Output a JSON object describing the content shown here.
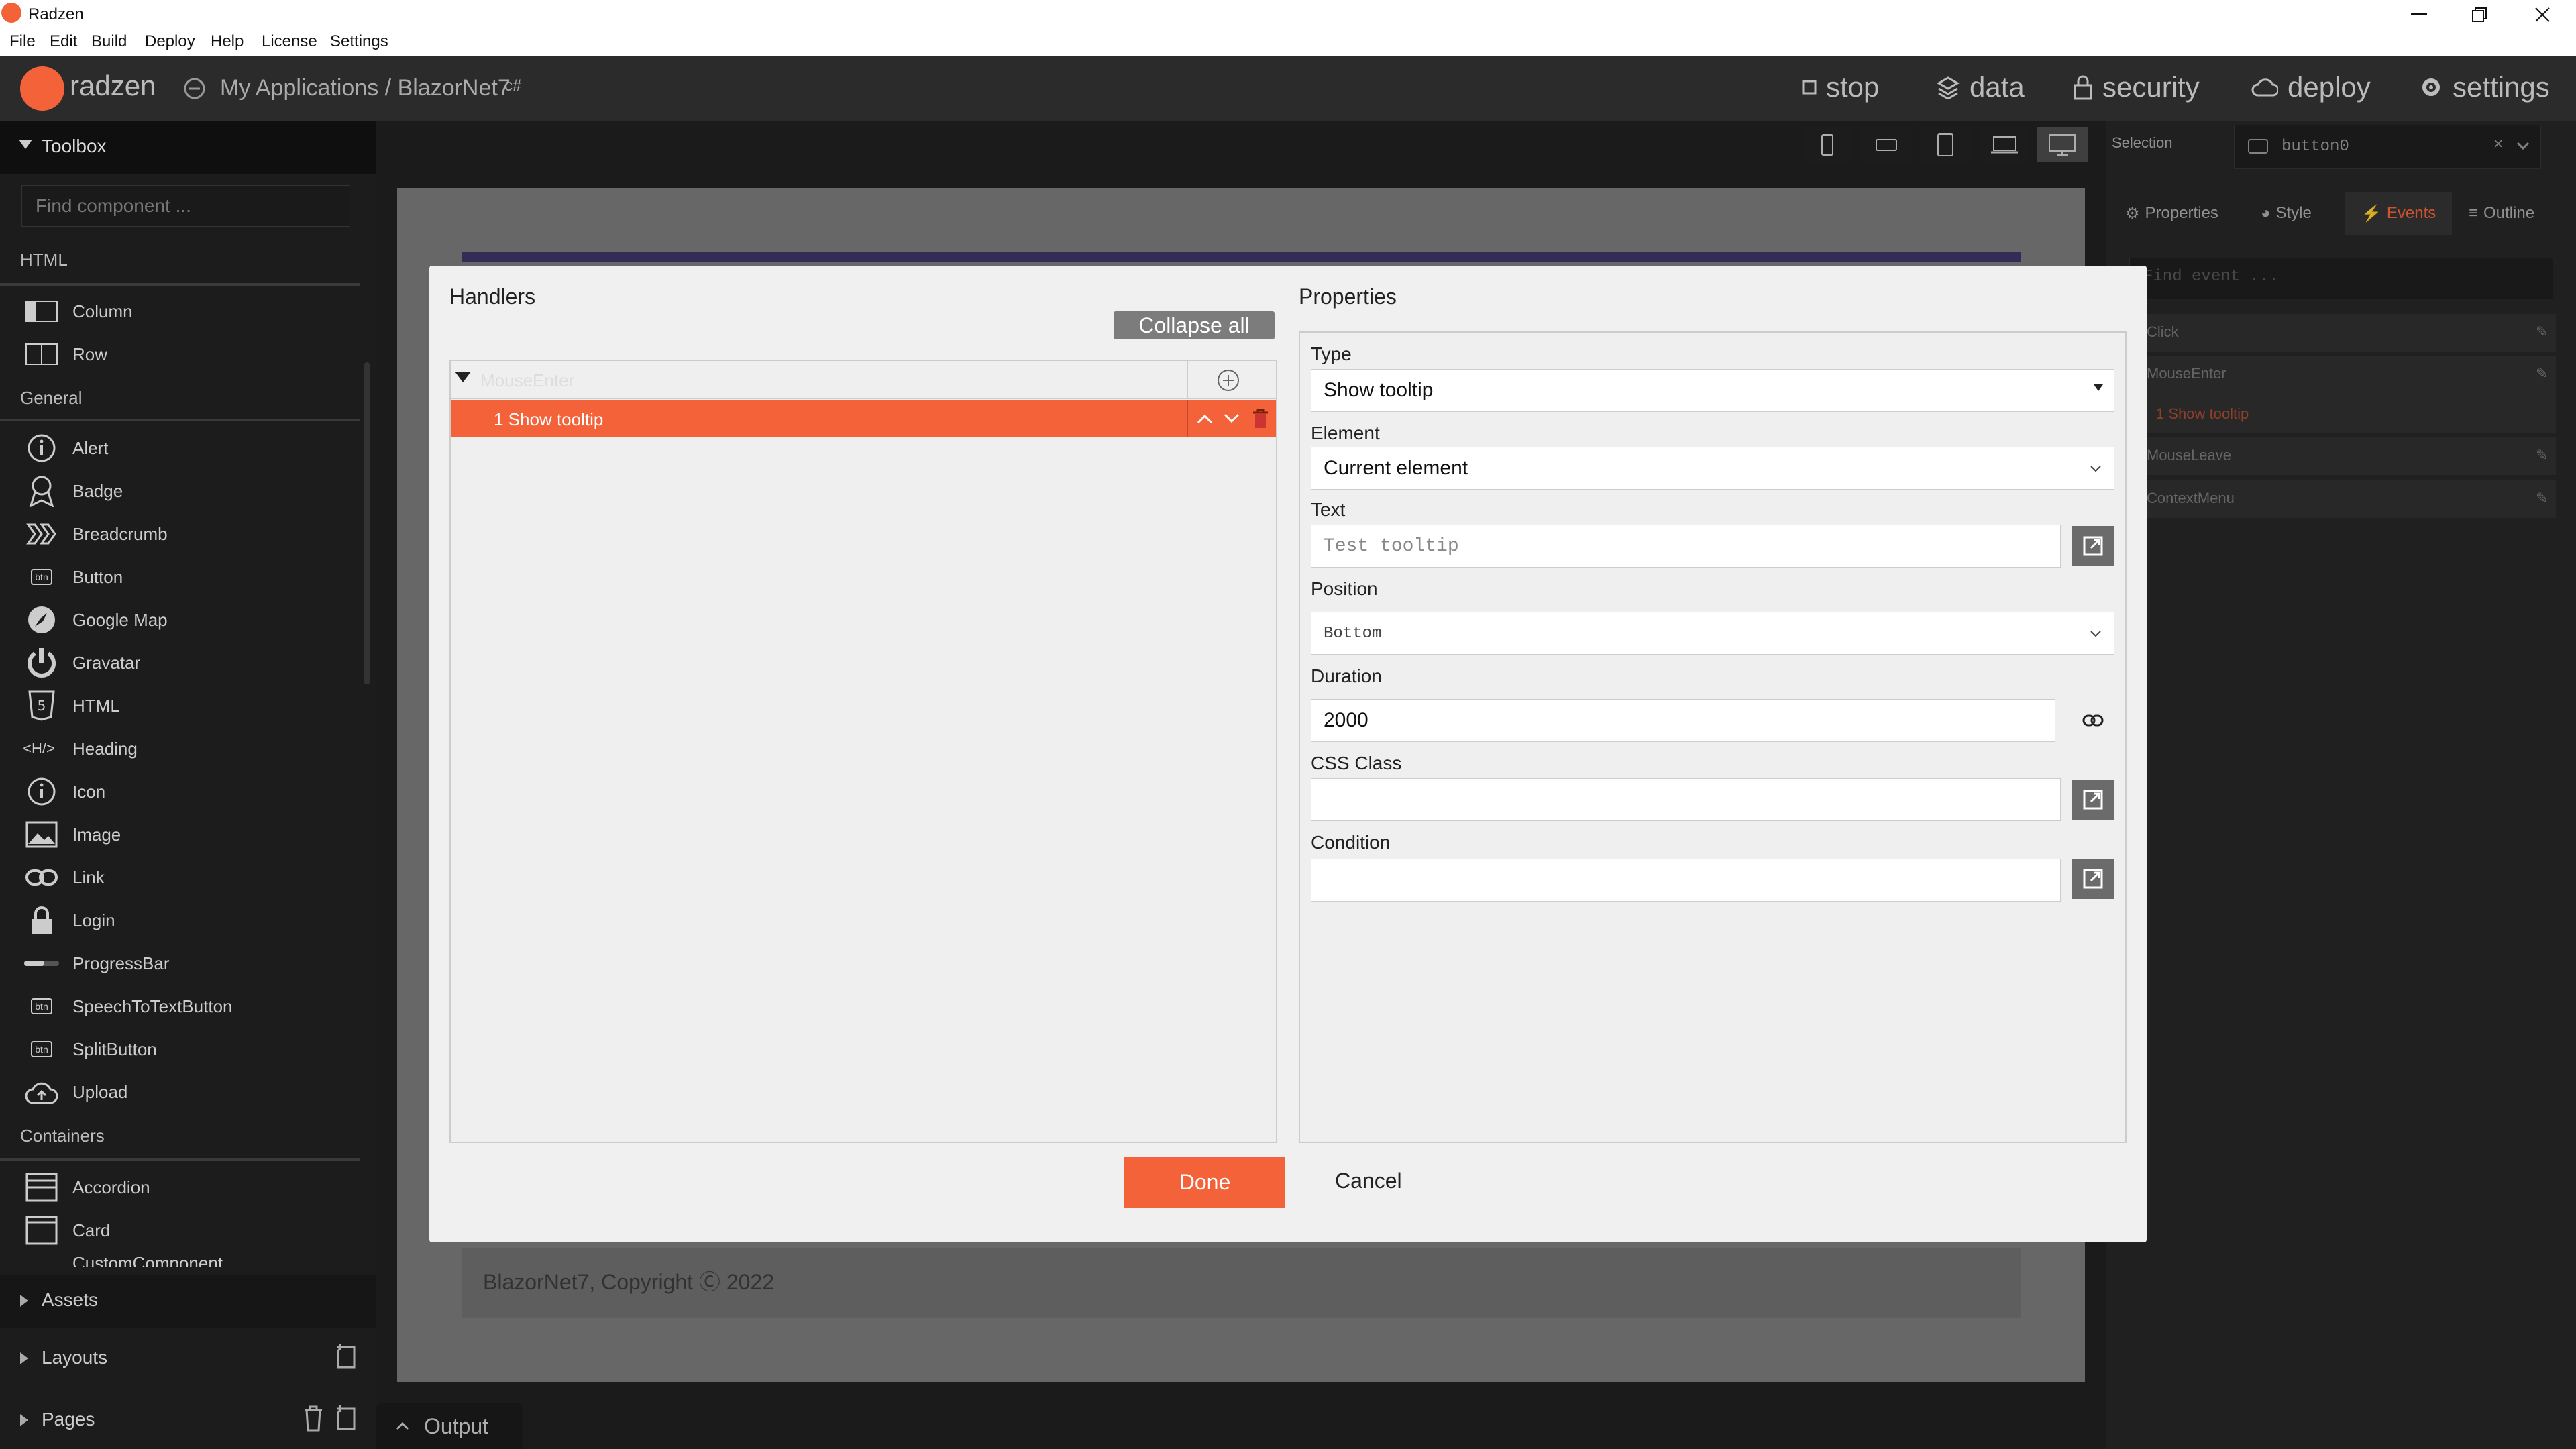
{
  "window": {
    "title": "Radzen"
  },
  "menu": [
    "File",
    "Edit",
    "Build",
    "Deploy",
    "Help",
    "License",
    "Settings"
  ],
  "appbar": {
    "logo": "radzen",
    "breadcrumb": "My Applications / BlazorNet7",
    "lang_badge": "c#",
    "nav": {
      "stop": "stop",
      "data": "data",
      "security": "security",
      "deploy": "deploy",
      "settings": "settings"
    }
  },
  "toolbox": {
    "title": "Toolbox",
    "search_placeholder": "Find component ...",
    "categories": {
      "html": "HTML",
      "general": "General",
      "containers": "Containers"
    },
    "html_items": [
      "Column",
      "Row"
    ],
    "general_items": [
      "Alert",
      "Badge",
      "Breadcrumb",
      "Button",
      "Google Map",
      "Gravatar",
      "HTML",
      "Heading",
      "Icon",
      "Image",
      "Link",
      "Login",
      "ProgressBar",
      "SpeechToTextButton",
      "SplitButton",
      "Upload"
    ],
    "container_items": [
      "Accordion",
      "Card",
      "CustomComponent"
    ],
    "icons": {
      "heading": "<H/>",
      "btn": "btn"
    }
  },
  "left_sections": {
    "assets": "Assets",
    "layouts": "Layouts",
    "pages": "Pages"
  },
  "output_tab": "Output",
  "canvas": {
    "footer_text": "BlazorNet7, Copyright Ⓒ 2022"
  },
  "right_panel": {
    "selection_label": "Selection",
    "selection_value": "button0",
    "tabs": [
      "Properties",
      "Style",
      "Events",
      "Outline"
    ],
    "active_tab": "Events",
    "find_event_placeholder": "Find event ...",
    "events": [
      "Click",
      "MouseEnter",
      "MouseLeave",
      "ContextMenu"
    ],
    "mouseenter_handler": "1 Show tooltip"
  },
  "dialog": {
    "handlers_title": "Handlers",
    "collapse_all": "Collapse all",
    "event_name": "MouseEnter",
    "handler_item": "1 Show tooltip",
    "properties_title": "Properties",
    "type": {
      "label": "Type",
      "value": "Show tooltip"
    },
    "element": {
      "label": "Element",
      "value": "Current element"
    },
    "text": {
      "label": "Text",
      "placeholder": "Test tooltip"
    },
    "position": {
      "label": "Position",
      "value": "Bottom"
    },
    "duration": {
      "label": "Duration",
      "value": "2000"
    },
    "css_class": {
      "label": "CSS Class",
      "value": ""
    },
    "condition": {
      "label": "Condition",
      "value": ""
    },
    "done": "Done",
    "cancel": "Cancel"
  },
  "colors": {
    "accent": "#f4623a",
    "dialog_bg": "#f0f0f0",
    "panel_bg": "#1c1c1c"
  }
}
